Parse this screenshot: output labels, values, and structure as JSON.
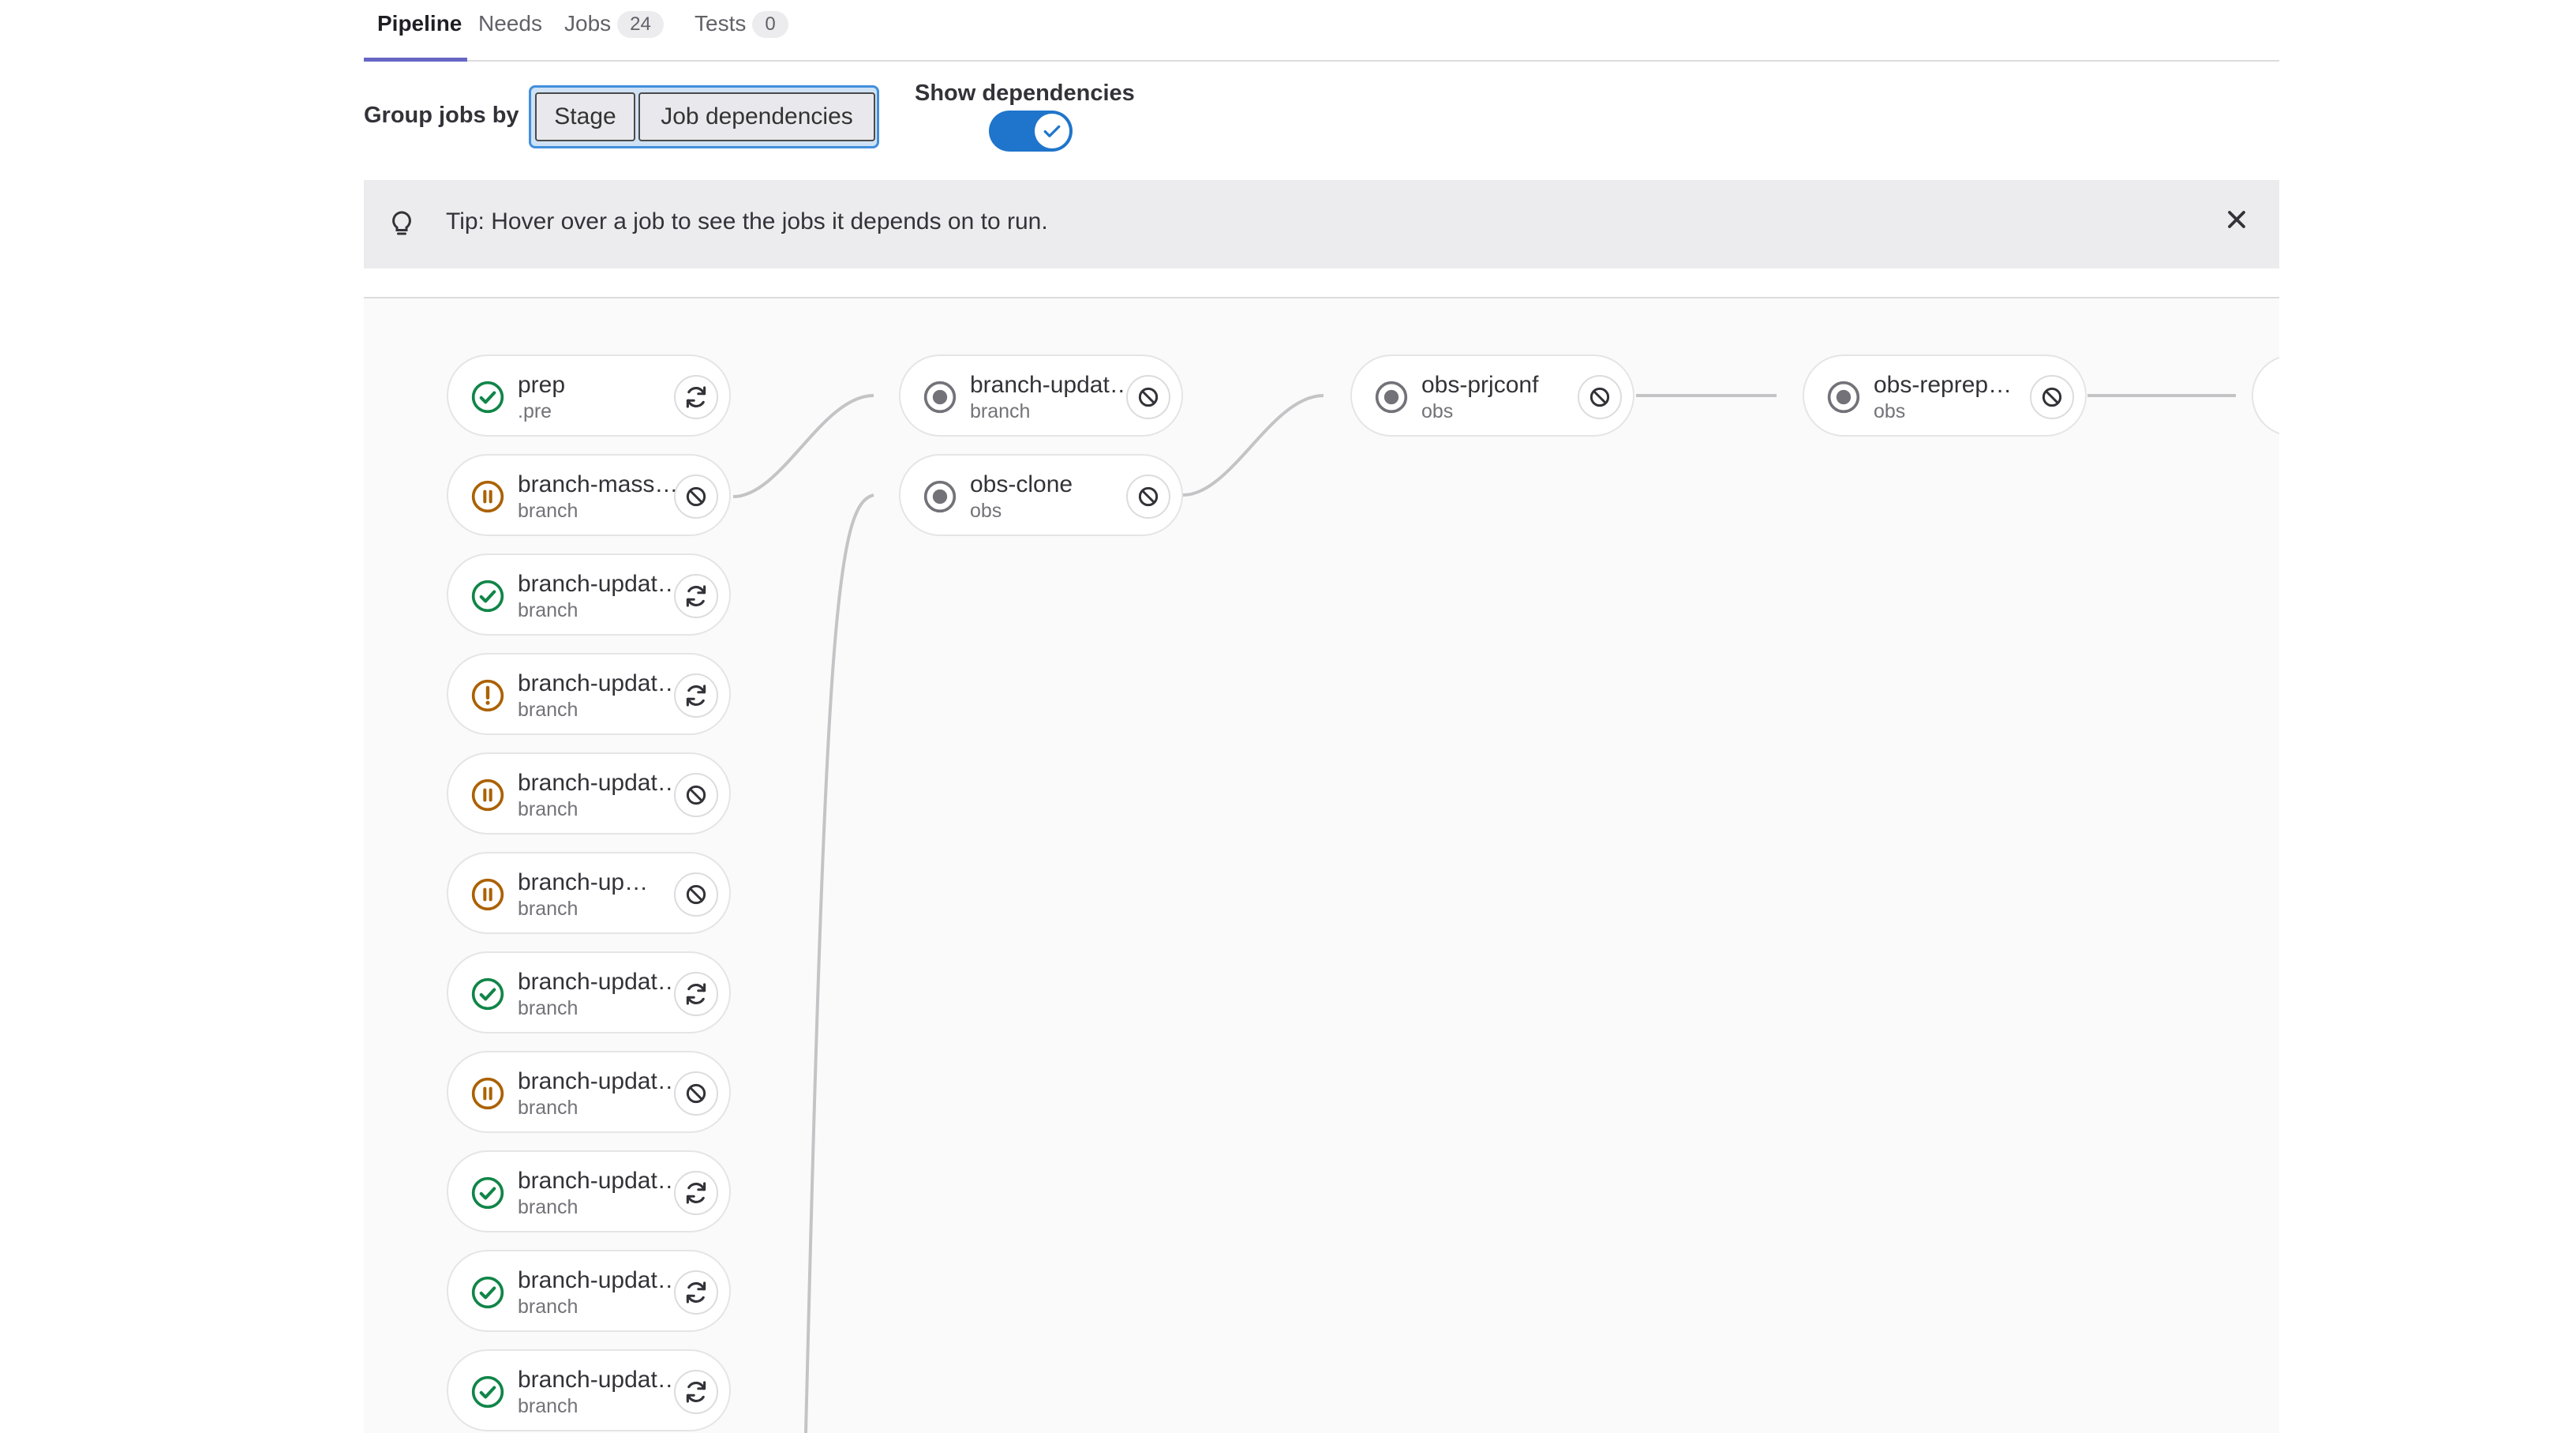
{
  "tabs": [
    {
      "label": "Pipeline",
      "count": null,
      "active": true
    },
    {
      "label": "Needs",
      "count": null,
      "active": false
    },
    {
      "label": "Jobs",
      "count": "24",
      "active": false
    },
    {
      "label": "Tests",
      "count": "0",
      "active": false
    }
  ],
  "group_by": {
    "label": "Group jobs by",
    "stage_label": "Stage",
    "deps_label": "Job dependencies"
  },
  "show_deps": {
    "label": "Show dependencies",
    "enabled": true
  },
  "tip": {
    "text": "Tip: Hover over a job to see the jobs it depends on to run."
  },
  "columns": [
    {
      "jobs": [
        {
          "name": "prep",
          "stage": ".pre",
          "status": "success",
          "action": "retry"
        },
        {
          "name": "branch-mass…",
          "stage": "branch",
          "status": "manual",
          "action": "cancel"
        },
        {
          "name": "branch-updat…",
          "stage": "branch",
          "status": "success",
          "action": "retry"
        },
        {
          "name": "branch-updat…",
          "stage": "branch",
          "status": "warning",
          "action": "retry"
        },
        {
          "name": "branch-updat…",
          "stage": "branch",
          "status": "manual",
          "action": "cancel"
        },
        {
          "name": "branch-up…",
          "stage": "branch",
          "status": "manual",
          "action": "cancel"
        },
        {
          "name": "branch-updat…",
          "stage": "branch",
          "status": "success",
          "action": "retry"
        },
        {
          "name": "branch-updat…",
          "stage": "branch",
          "status": "manual",
          "action": "cancel"
        },
        {
          "name": "branch-updat…",
          "stage": "branch",
          "status": "success",
          "action": "retry"
        },
        {
          "name": "branch-updat…",
          "stage": "branch",
          "status": "success",
          "action": "retry"
        },
        {
          "name": "branch-updat…",
          "stage": "branch",
          "status": "success",
          "action": "retry"
        }
      ]
    },
    {
      "jobs": [
        {
          "name": "branch-updat…",
          "stage": "branch",
          "status": "created",
          "action": "cancel"
        },
        {
          "name": "obs-clone",
          "stage": "obs",
          "status": "created",
          "action": "cancel"
        }
      ]
    },
    {
      "jobs": [
        {
          "name": "obs-prjconf",
          "stage": "obs",
          "status": "created",
          "action": "cancel"
        }
      ]
    },
    {
      "jobs": [
        {
          "name": "obs-reprep…",
          "stage": "obs",
          "status": "created",
          "action": "cancel"
        }
      ]
    }
  ],
  "colors": {
    "success": "#108548",
    "manual": "#ab6100",
    "warning": "#ab6100",
    "created": "#737278",
    "accent": "#1f75cb",
    "tab_active": "#6666c4"
  }
}
